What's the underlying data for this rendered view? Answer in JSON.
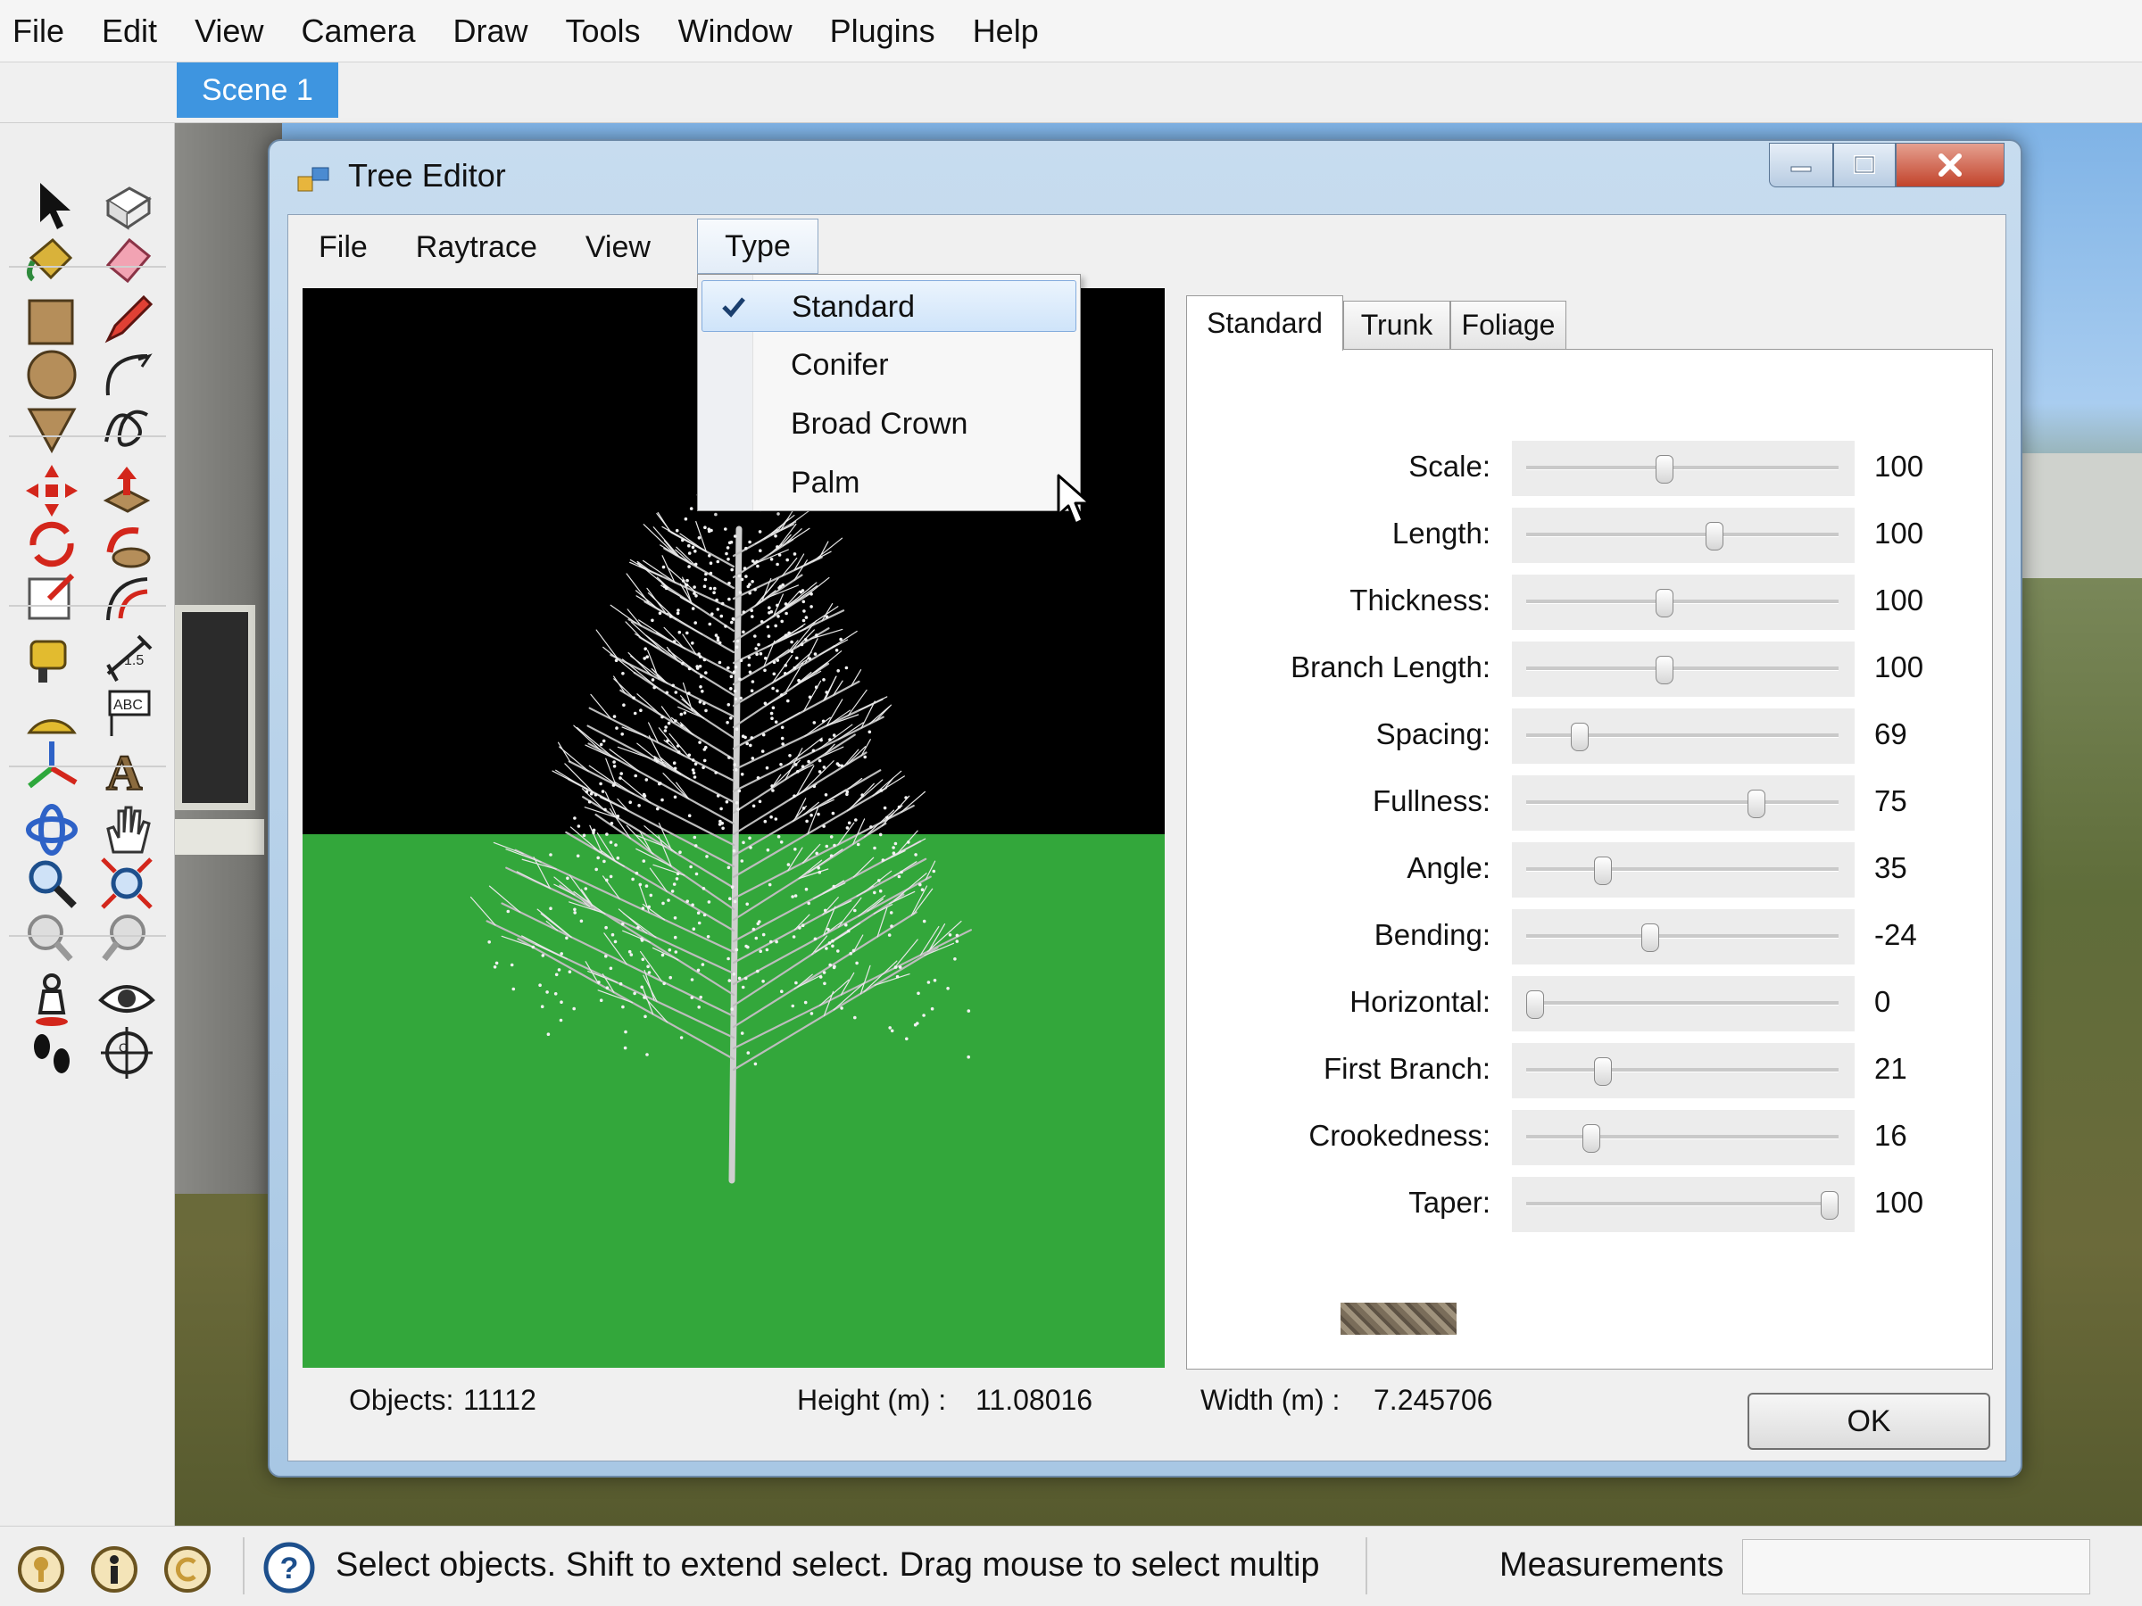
{
  "app_menu": [
    "File",
    "Edit",
    "View",
    "Camera",
    "Draw",
    "Tools",
    "Window",
    "Plugins",
    "Help"
  ],
  "scene_tab": "Scene 1",
  "toolbar": [
    {
      "name": "select-icon"
    },
    {
      "name": "make-component-icon"
    },
    {
      "name": "paint-bucket-icon"
    },
    {
      "name": "eraser-icon"
    },
    {
      "name": "rectangle-icon"
    },
    {
      "name": "pencil-icon"
    },
    {
      "name": "circle-icon"
    },
    {
      "name": "arc-icon"
    },
    {
      "name": "polygon-icon"
    },
    {
      "name": "freehand-icon"
    },
    {
      "name": "move-icon"
    },
    {
      "name": "push-pull-icon"
    },
    {
      "name": "rotate-icon"
    },
    {
      "name": "follow-me-icon"
    },
    {
      "name": "scale-icon"
    },
    {
      "name": "offset-icon"
    },
    {
      "name": "tape-measure-icon"
    },
    {
      "name": "dimension-icon"
    },
    {
      "name": "protractor-icon"
    },
    {
      "name": "text-icon"
    },
    {
      "name": "axes-icon"
    },
    {
      "name": "3d-text-icon"
    },
    {
      "name": "orbit-icon"
    },
    {
      "name": "pan-icon"
    },
    {
      "name": "zoom-icon"
    },
    {
      "name": "zoom-extents-icon"
    },
    {
      "name": "previous-view-icon"
    },
    {
      "name": "next-view-icon"
    },
    {
      "name": "position-camera-icon"
    },
    {
      "name": "look-around-icon"
    },
    {
      "name": "walk-icon"
    },
    {
      "name": "section-plane-icon"
    }
  ],
  "tree_editor": {
    "title": "Tree Editor",
    "menu": [
      "File",
      "Raytrace",
      "View"
    ],
    "menu_open": "Type",
    "type_options": [
      {
        "label": "Standard",
        "checked": true
      },
      {
        "label": "Conifer",
        "checked": false
      },
      {
        "label": "Broad Crown",
        "checked": false
      },
      {
        "label": "Palm",
        "checked": false
      }
    ],
    "tabs": [
      "Standard",
      "Trunk",
      "Foliage"
    ],
    "active_tab": "Standard",
    "sliders": [
      {
        "label": "Scale:",
        "value": "100",
        "level": 0.44
      },
      {
        "label": "Length:",
        "value": "100",
        "level": 0.61
      },
      {
        "label": "Thickness:",
        "value": "100",
        "level": 0.44
      },
      {
        "label": "Branch Length:",
        "value": "100",
        "level": 0.44
      },
      {
        "label": "Spacing:",
        "value": "69",
        "level": 0.15
      },
      {
        "label": "Fullness:",
        "value": "75",
        "level": 0.75
      },
      {
        "label": "Angle:",
        "value": "35",
        "level": 0.23
      },
      {
        "label": "Bending:",
        "value": "-24",
        "level": 0.39
      },
      {
        "label": "Horizontal:",
        "value": "0",
        "level": 0.0
      },
      {
        "label": "First Branch:",
        "value": "21",
        "level": 0.23
      },
      {
        "label": "Crookedness:",
        "value": "16",
        "level": 0.19
      },
      {
        "label": "Taper:",
        "value": "100",
        "level": 1.0
      }
    ],
    "status": {
      "objects_label": "Objects:",
      "objects_value": "11112",
      "height_label": "Height (m) :",
      "height_value": "11.08016",
      "width_label": "Width (m) :",
      "width_value": "7.245706"
    },
    "ok_label": "OK"
  },
  "statusbar": {
    "message": "Select objects. Shift to extend select. Drag mouse to select multip",
    "measurements_label": "Measurements"
  },
  "colors": {
    "scene_tab": "#3e95e0",
    "preview_sky": "#000000",
    "preview_ground": "#33a73b",
    "dropdown_highlight": "#cfe4fa"
  }
}
